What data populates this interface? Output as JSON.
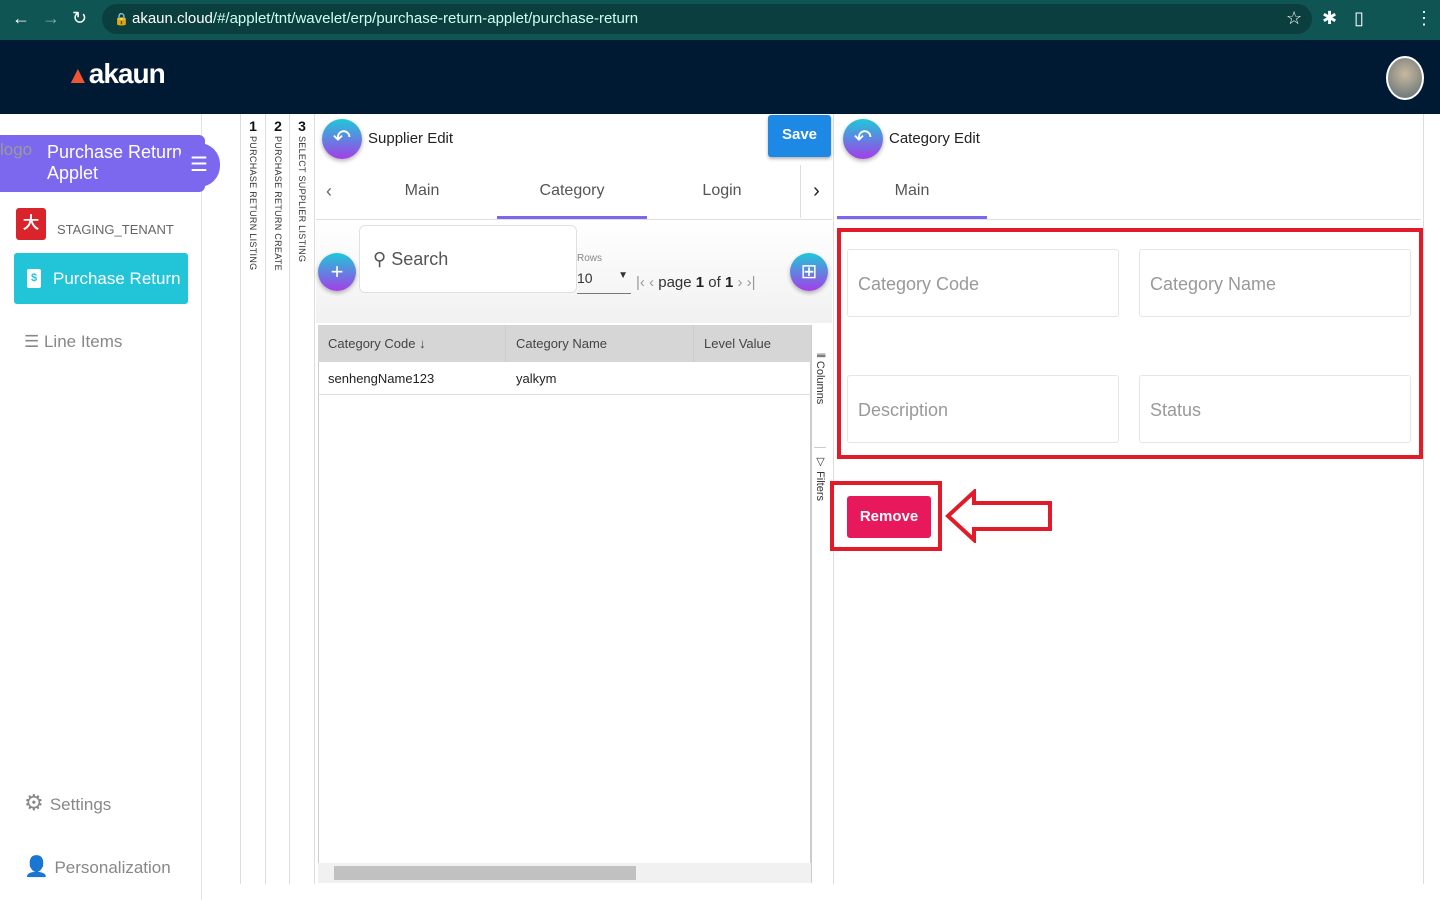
{
  "browser": {
    "url_host": "akaun.cloud",
    "url_path": "/#/applet/tnt/wavelet/erp/purchase-return-applet/purchase-return"
  },
  "header": {
    "brand": "akaun"
  },
  "sidebar": {
    "logo_alt": "logo",
    "applet_title": "Purchase Return Applet",
    "tenant": "STAGING_TENANT",
    "active_item": "Purchase Return",
    "items": [
      {
        "label": "Line Items"
      },
      {
        "label": "Settings"
      },
      {
        "label": "Personalization"
      }
    ]
  },
  "vertical_tabs": [
    {
      "num": "1",
      "label": "PURCHASE RETURN LISTING"
    },
    {
      "num": "2",
      "label": "PURCHASE RETURN CREATE"
    },
    {
      "num": "3",
      "label": "SELECT SUPPLIER LISTING"
    }
  ],
  "supplier_panel": {
    "title": "Supplier Edit",
    "save": "Save",
    "tabs": [
      "Main",
      "Category",
      "Login"
    ],
    "active_tab": "Category",
    "search_placeholder": "Search",
    "rows_label": "Rows",
    "rows_value": "10",
    "page_label": "page",
    "page": "1",
    "of_label": "of",
    "pages": "1",
    "columns": [
      "Category Code",
      "Category Name",
      "Level Value"
    ],
    "rows": [
      [
        "senhengName123",
        "yalkym",
        ""
      ]
    ],
    "side_tools": [
      "Columns",
      "Filters"
    ]
  },
  "category_panel": {
    "title": "Category Edit",
    "tabs": [
      "Main"
    ],
    "active_tab": "Main",
    "fields": {
      "code": "Category Code",
      "name": "Category Name",
      "description": "Description",
      "status": "Status"
    },
    "remove": "Remove"
  }
}
